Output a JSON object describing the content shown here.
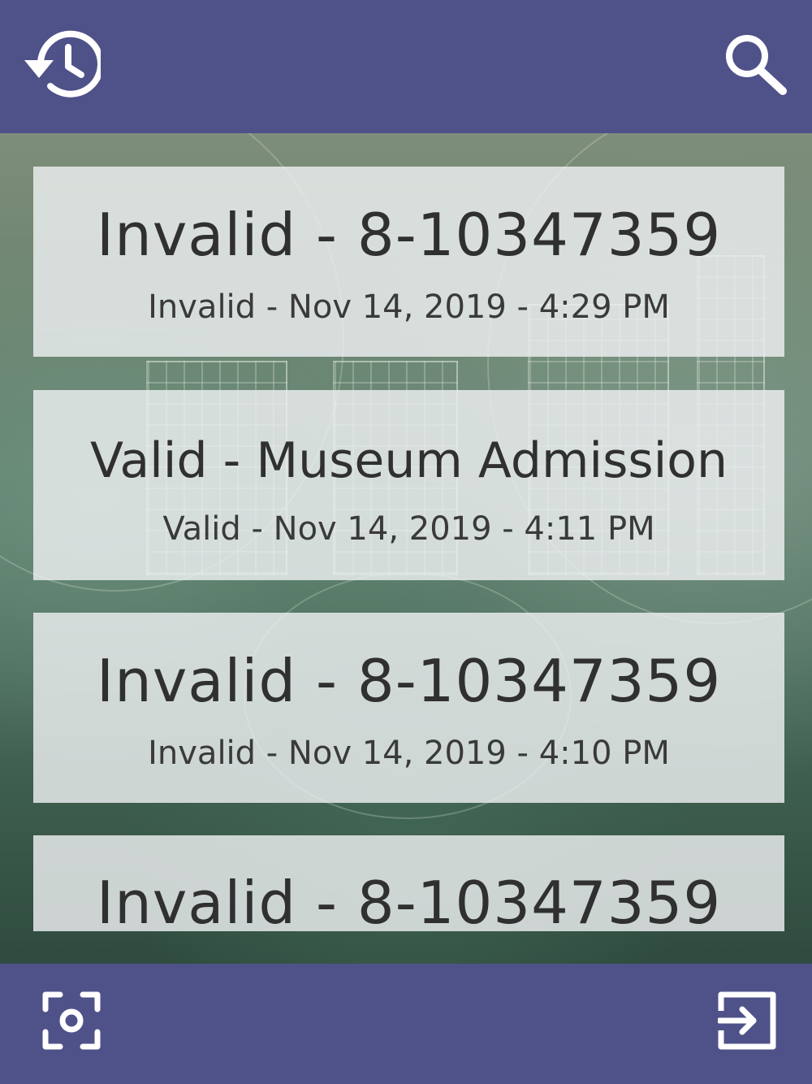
{
  "toolbar": {
    "history_icon": "history-icon",
    "search_icon": "search-icon"
  },
  "entries": [
    {
      "title": "Invalid - 8-10347359",
      "subtitle": "Invalid - Nov 14, 2019 - 4:29 PM"
    },
    {
      "title": "Valid - Museum Admission",
      "subtitle": "Valid - Nov 14, 2019 - 4:11 PM"
    },
    {
      "title": "Invalid - 8-10347359",
      "subtitle": "Invalid - Nov 14, 2019 - 4:10 PM"
    },
    {
      "title": "Invalid - 8-10347359",
      "subtitle": ""
    }
  ],
  "bottombar": {
    "scan_icon": "scan-icon",
    "logout_icon": "logout-icon"
  },
  "colors": {
    "bar": "#4f5289",
    "card": "#eef0f2",
    "text": "#303030"
  }
}
